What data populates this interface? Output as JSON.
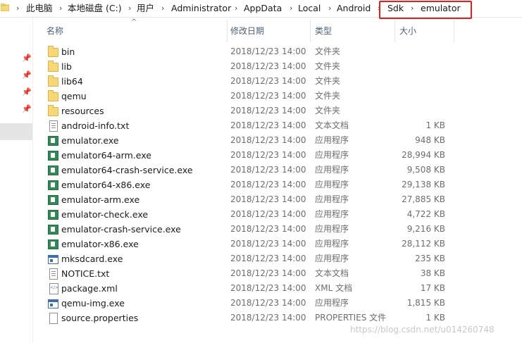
{
  "address_bar": {
    "crumbs": [
      "此电脑",
      "本地磁盘 (C:)",
      "用户",
      "Administrator",
      "AppData",
      "Local",
      "Android",
      "Sdk",
      "emulator"
    ],
    "separator": "›"
  },
  "columns": {
    "name": "名称",
    "modified": "修改日期",
    "type": "类型",
    "size": "大小"
  },
  "files": [
    {
      "name": "bin",
      "date": "2018/12/23 14:00",
      "type": "文件夹",
      "size": "",
      "icon": "folder-icon"
    },
    {
      "name": "lib",
      "date": "2018/12/23 14:00",
      "type": "文件夹",
      "size": "",
      "icon": "folder-icon"
    },
    {
      "name": "lib64",
      "date": "2018/12/23 14:00",
      "type": "文件夹",
      "size": "",
      "icon": "folder-icon"
    },
    {
      "name": "qemu",
      "date": "2018/12/23 14:00",
      "type": "文件夹",
      "size": "",
      "icon": "folder-icon"
    },
    {
      "name": "resources",
      "date": "2018/12/23 14:00",
      "type": "文件夹",
      "size": "",
      "icon": "folder-icon"
    },
    {
      "name": "android-info.txt",
      "date": "2018/12/23 14:00",
      "type": "文本文档",
      "size": "1 KB",
      "icon": "text-file-icon"
    },
    {
      "name": "emulator.exe",
      "date": "2018/12/23 14:00",
      "type": "应用程序",
      "size": "948 KB",
      "icon": "exe-icon"
    },
    {
      "name": "emulator64-arm.exe",
      "date": "2018/12/23 14:00",
      "type": "应用程序",
      "size": "28,994 KB",
      "icon": "exe-icon"
    },
    {
      "name": "emulator64-crash-service.exe",
      "date": "2018/12/23 14:00",
      "type": "应用程序",
      "size": "9,508 KB",
      "icon": "exe-icon"
    },
    {
      "name": "emulator64-x86.exe",
      "date": "2018/12/23 14:00",
      "type": "应用程序",
      "size": "29,138 KB",
      "icon": "exe-icon"
    },
    {
      "name": "emulator-arm.exe",
      "date": "2018/12/23 14:00",
      "type": "应用程序",
      "size": "27,885 KB",
      "icon": "exe-icon"
    },
    {
      "name": "emulator-check.exe",
      "date": "2018/12/23 14:00",
      "type": "应用程序",
      "size": "4,722 KB",
      "icon": "exe-icon"
    },
    {
      "name": "emulator-crash-service.exe",
      "date": "2018/12/23 14:00",
      "type": "应用程序",
      "size": "9,216 KB",
      "icon": "exe-icon"
    },
    {
      "name": "emulator-x86.exe",
      "date": "2018/12/23 14:00",
      "type": "应用程序",
      "size": "28,112 KB",
      "icon": "exe-icon"
    },
    {
      "name": "mksdcard.exe",
      "date": "2018/12/23 14:00",
      "type": "应用程序",
      "size": "235 KB",
      "icon": "window-app-icon"
    },
    {
      "name": "NOTICE.txt",
      "date": "2018/12/23 14:00",
      "type": "文本文档",
      "size": "38 KB",
      "icon": "text-file-icon"
    },
    {
      "name": "package.xml",
      "date": "2018/12/23 14:00",
      "type": "XML 文档",
      "size": "17 KB",
      "icon": "xml-file-icon"
    },
    {
      "name": "qemu-img.exe",
      "date": "2018/12/23 14:00",
      "type": "应用程序",
      "size": "1,815 KB",
      "icon": "window-app-icon"
    },
    {
      "name": "source.properties",
      "date": "2018/12/23 14:00",
      "type": "PROPERTIES 文件",
      "size": "1 KB",
      "icon": "blank-file-icon"
    }
  ],
  "watermark": "https://blog.csdn.net/u014260748",
  "colors": {
    "highlight": "#e02020",
    "header_text": "#4c607a",
    "folder": "#f8d775"
  }
}
